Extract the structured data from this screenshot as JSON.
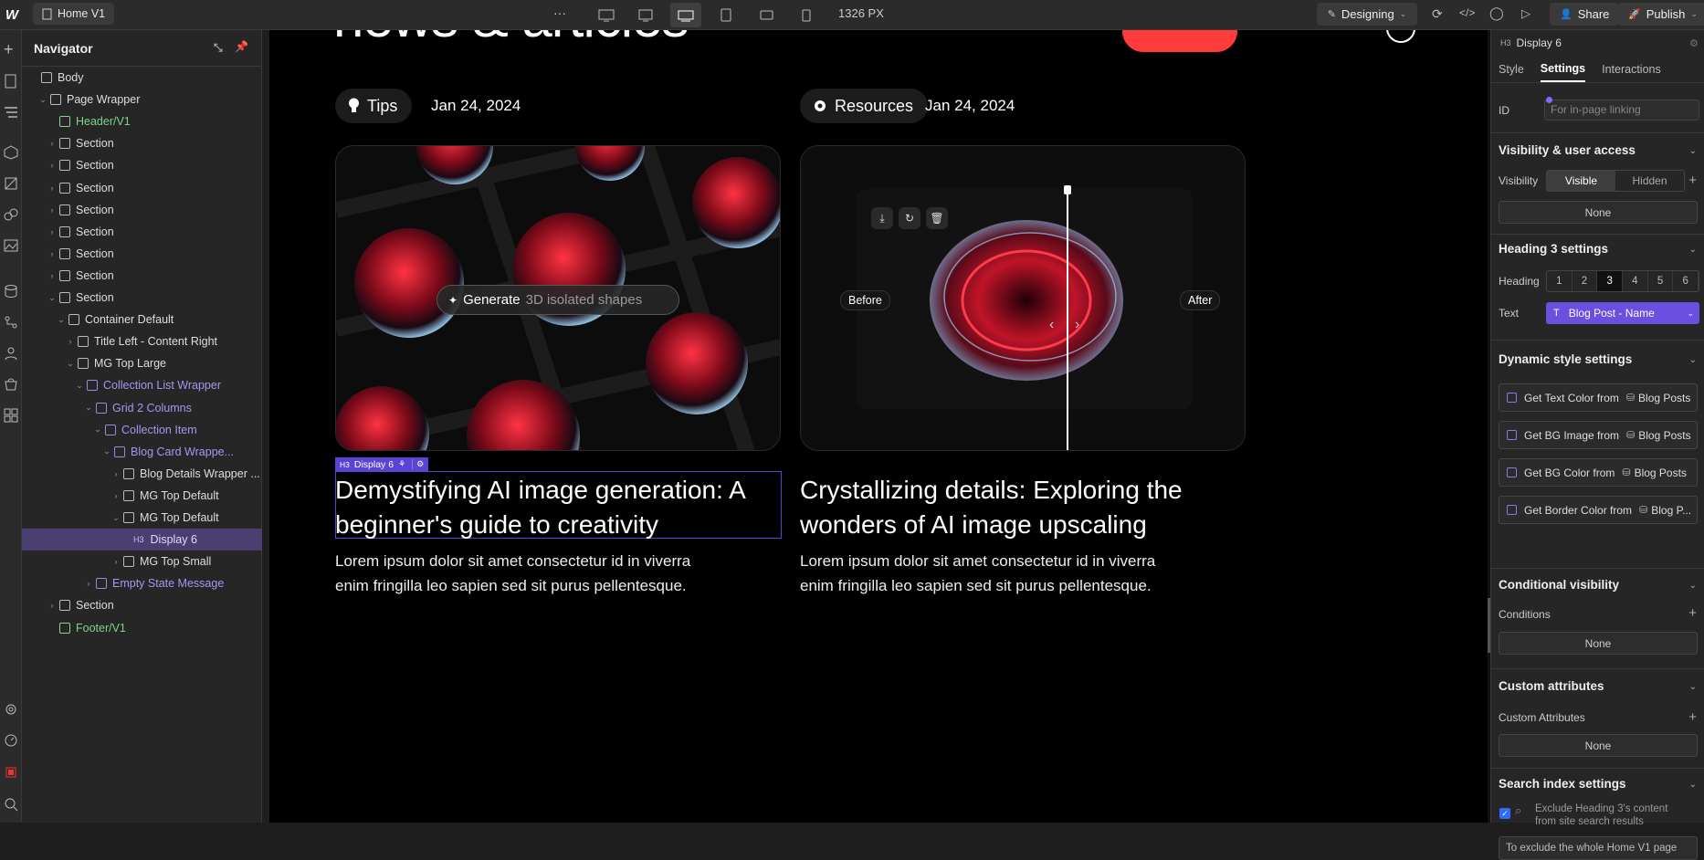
{
  "topbar": {
    "page_name": "Home V1",
    "more": "···",
    "width": "1326 PX",
    "mode": "Designing",
    "share": "Share",
    "publish": "Publish"
  },
  "navigator": {
    "title": "Navigator",
    "items": [
      {
        "label": "Body",
        "depth": 0
      },
      {
        "label": "Page Wrapper",
        "depth": 1
      },
      {
        "label": "Header/V1",
        "depth": 2
      },
      {
        "label": "Section",
        "depth": 2
      },
      {
        "label": "Section",
        "depth": 2
      },
      {
        "label": "Section",
        "depth": 2
      },
      {
        "label": "Section",
        "depth": 2
      },
      {
        "label": "Section",
        "depth": 2
      },
      {
        "label": "Section",
        "depth": 2
      },
      {
        "label": "Section",
        "depth": 2
      },
      {
        "label": "Section",
        "depth": 2
      },
      {
        "label": "Container Default",
        "depth": 3
      },
      {
        "label": "Title Left - Content Right",
        "depth": 4
      },
      {
        "label": "MG Top Large",
        "depth": 4
      },
      {
        "label": "Collection List Wrapper",
        "depth": 5
      },
      {
        "label": "Grid 2 Columns",
        "depth": 6
      },
      {
        "label": "Collection Item",
        "depth": 7
      },
      {
        "label": "Blog Card Wrappe...",
        "depth": 8
      },
      {
        "label": "Blog Details Wrapper ...",
        "depth": 9
      },
      {
        "label": "MG Top Default",
        "depth": 9
      },
      {
        "label": "MG Top Default",
        "depth": 9
      },
      {
        "label": "Display 6",
        "depth": 10
      },
      {
        "label": "MG Top Small",
        "depth": 9
      },
      {
        "label": "Empty State Message",
        "depth": 6
      },
      {
        "label": "Section",
        "depth": 2
      },
      {
        "label": "Footer/V1",
        "depth": 2
      }
    ]
  },
  "canvas": {
    "card1": {
      "tag": "Tips",
      "date": "Jan 24, 2024",
      "title_line1": "Demystifying AI image generation: A",
      "title_line2": "beginner's guide to creativity",
      "body_line1": "Lorem ipsum dolor sit amet consectetur id in viverra",
      "body_line2": "enim fringilla leo sapien sed sit purus pellentesque.",
      "generate_label": "Generate",
      "generate_hint": "3D isolated shapes",
      "badge": "Display 6"
    },
    "card2": {
      "tag": "Resources",
      "date": "Jan 24, 2024",
      "title_line1": "Crystallizing details: Exploring the",
      "title_line2": "wonders of AI image upscaling",
      "body_line1": "Lorem ipsum dolor sit amet consectetur id in viverra",
      "body_line2": "enim fringilla leo sapien sed sit purus pellentesque.",
      "before": "Before",
      "after": "After"
    }
  },
  "panel": {
    "element": "Display 6",
    "tabs": [
      "Style",
      "Settings",
      "Interactions"
    ],
    "id_label": "ID",
    "id_placeholder": "For in-page linking",
    "visibility_title": "Visibility & user access",
    "visibility_label": "Visibility",
    "visible": "Visible",
    "hidden": "Hidden",
    "none": "None",
    "heading_title": "Heading 3 settings",
    "heading_label": "Heading",
    "heading_levels": [
      "1",
      "2",
      "3",
      "4",
      "5",
      "6"
    ],
    "text_label": "Text",
    "text_value": "Blog Post - Name",
    "dynamic_title": "Dynamic style settings",
    "dynamic": [
      "Get Text Color from",
      "Get BG Image from",
      "Get BG Color from",
      "Get Border Color from"
    ],
    "dynamic_src": [
      "Blog Posts",
      "Blog Posts",
      "Blog Posts",
      "Blog P..."
    ],
    "conditional_title": "Conditional visibility",
    "conditions_label": "Conditions",
    "custom_title": "Custom attributes",
    "custom_label": "Custom Attributes",
    "search_title": "Search index settings",
    "search_text1": "Exclude Heading 3's content",
    "search_text2": "from site search results",
    "search_note": "To exclude the whole Home V1 page"
  },
  "colors": {
    "accent": "#5b43d6",
    "selection": "#4a3f70",
    "red": "#ff3b3b"
  }
}
